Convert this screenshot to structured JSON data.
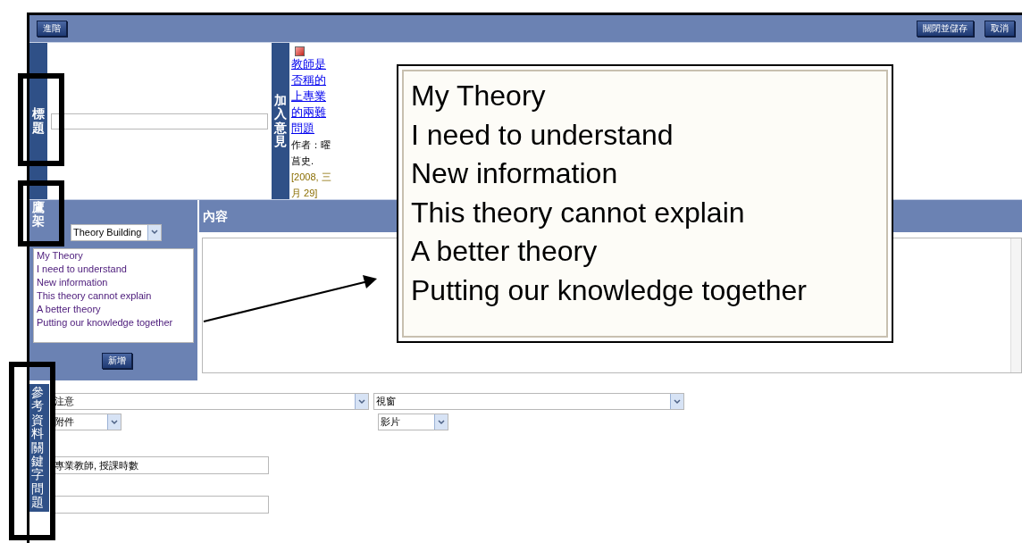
{
  "toolbar": {
    "left_button": "進階",
    "right_buttons": [
      "關閉並儲存",
      "取消"
    ]
  },
  "title_field": {
    "label": "標題"
  },
  "comment": {
    "label": "加入意見",
    "link": "教師是否稱的上專業的兩難問題",
    "author": "作者：曜菖史.",
    "date": "[2008, 三月 29]"
  },
  "scaffold": {
    "label": "鷹架",
    "select": "Theory Building",
    "items": [
      "My Theory",
      "I need to understand",
      "New information",
      "This theory cannot explain",
      "A better theory",
      "Putting our knowledge together"
    ],
    "add_button": "新增"
  },
  "content": {
    "label": "內容"
  },
  "references": {
    "label": "參考資料關鍵字問題",
    "selects": [
      "注意",
      "視窗",
      "附件",
      "影片"
    ],
    "keywords": "專業教師, 授課時數"
  },
  "callout": {
    "items": [
      "My Theory",
      "I need to understand",
      "New information",
      "This theory cannot explain",
      "A better theory",
      "Putting our knowledge together"
    ]
  }
}
